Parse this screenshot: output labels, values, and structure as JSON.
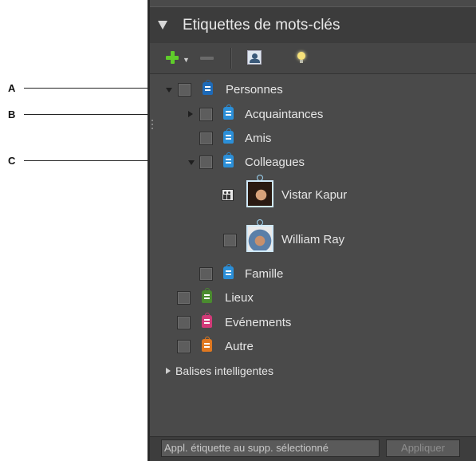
{
  "callouts": [
    "A",
    "B",
    "C"
  ],
  "panel": {
    "title": "Etiquettes de mots-clés",
    "footer": {
      "placeholder": "Appl. étiquette au supp. sélectionné",
      "apply_label": "Appliquer"
    }
  },
  "tree": {
    "personnes": "Personnes",
    "acquaintances": "Acquaintances",
    "amis": "Amis",
    "colleagues": "Colleagues",
    "vistar": "Vistar Kapur",
    "william": "William Ray",
    "famille": "Famille",
    "lieux": "Lieux",
    "evenements": "Evénements",
    "autre": "Autre",
    "balises": "Balises intelligentes"
  },
  "icons": {
    "personnes": "person-tag-icon",
    "acquaintances": "person-tag-icon",
    "lieux": "place-tag-icon",
    "evenements": "event-tag-icon",
    "autre": "other-tag-icon"
  },
  "colors": {
    "panel_bg": "#4a4a4a",
    "people_tag": "#2b8fd8",
    "places_tag": "#4a8b2f",
    "events_tag": "#d23a78",
    "other_tag": "#e07820",
    "add_icon": "#5fcc2a"
  }
}
